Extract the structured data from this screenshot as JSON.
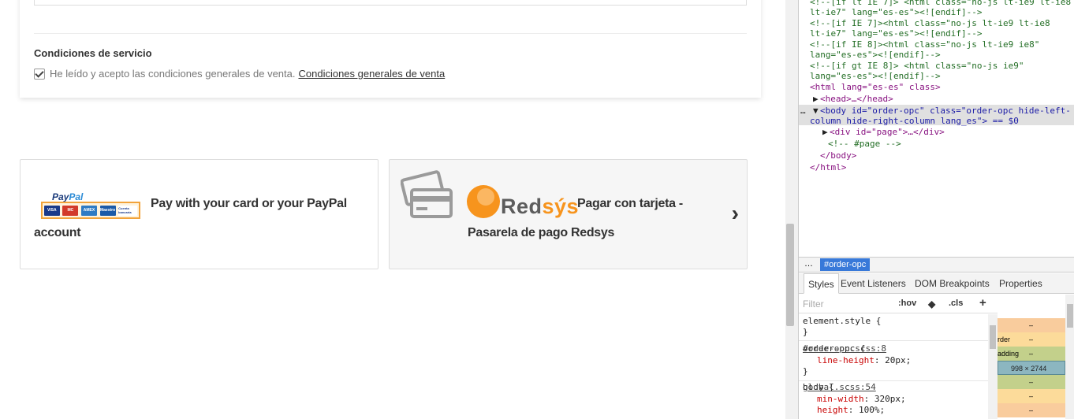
{
  "service": {
    "heading": "Condiciones de servicio",
    "terms_text": "He leído y acepto las condiciones generales de venta.",
    "terms_link": "Condiciones generales de venta",
    "checked": true
  },
  "payment_options": [
    {
      "label": "Pay with your card or your PayPal account",
      "logo_word_a": "Pay",
      "logo_word_b": "Pal",
      "cards": [
        "VISA",
        "MC",
        "AMEX",
        "Maestro",
        "Cuenta bancaria"
      ]
    },
    {
      "label": "Pagar con tarjeta - Pasarela de pago Redsys",
      "logo_text_a": "Red",
      "logo_text_b": "sýs",
      "chevron": "›"
    }
  ],
  "devtools": {
    "dom_lines": [
      "<!--[if lt IE 7]> <html class=\"no-js lt-ie9 lt-ie8",
      "lt-ie7\" lang=\"es-es\"><![endif]-->",
      "<!--[if IE 7]><html class=\"no-js lt-ie9 lt-ie8",
      "lt-ie7\" lang=\"es-es\"><![endif]-->",
      "<!--[if IE 8]><html class=\"no-js lt-ie9 ie8\"",
      "lang=\"es-es\"><![endif]-->",
      "<!--[if gt IE 8]> <html class=\"no-js ie9\"",
      "lang=\"es-es\"><![endif]-->"
    ],
    "html_open": "<html lang=\"es-es\" class>",
    "head_line": "<head>…</head>",
    "body_line_1": "<body id=\"order-opc\" class=\"order-opc hide-left-",
    "body_line_2": "column hide-right-column lang_es\"> == $0",
    "div_line": "<div id=\"page\">…</div>",
    "comment_line": "<!-- #page -->",
    "body_close": "</body>",
    "html_close": "</html>",
    "breadcrumb_dots": "…",
    "breadcrumb": "#order-opc",
    "tabs": [
      "Styles",
      "Event Listeners",
      "DOM Breakpoints",
      "Properties"
    ],
    "filter_placeholder": "Filter",
    "hov": ":hov",
    "cls": ".cls",
    "plus": "+",
    "rules": {
      "element_style": "element.style {",
      "element_close": "}",
      "r1_selector": "#order-opc {",
      "r1_source": "order-opc.scss:8",
      "r1_prop": "line-height",
      "r1_value": ": 20px;",
      "r1_close": "}",
      "r2_selector": "body {",
      "r2_source": "global.scss:54",
      "r2_prop1": "min-width",
      "r2_value1": ": 320px;",
      "r2_prop2": "height",
      "r2_value2": ": 100%;"
    },
    "box_model": {
      "rows": [
        {
          "label": "",
          "value": "–",
          "color": "#f9cc9d"
        },
        {
          "label": "rder",
          "value": "–",
          "color": "#fcdb9a"
        },
        {
          "label": "adding",
          "value": "–",
          "color": "#c3d08b"
        },
        {
          "label": "",
          "value": "998 × 2744",
          "color": "#8cb6c0"
        },
        {
          "label": "",
          "value": "–",
          "color": "#c3d08b"
        },
        {
          "label": "",
          "value": "–",
          "color": "#fcdb9a"
        },
        {
          "label": "",
          "value": "–",
          "color": "#f9cc9d"
        }
      ]
    }
  }
}
